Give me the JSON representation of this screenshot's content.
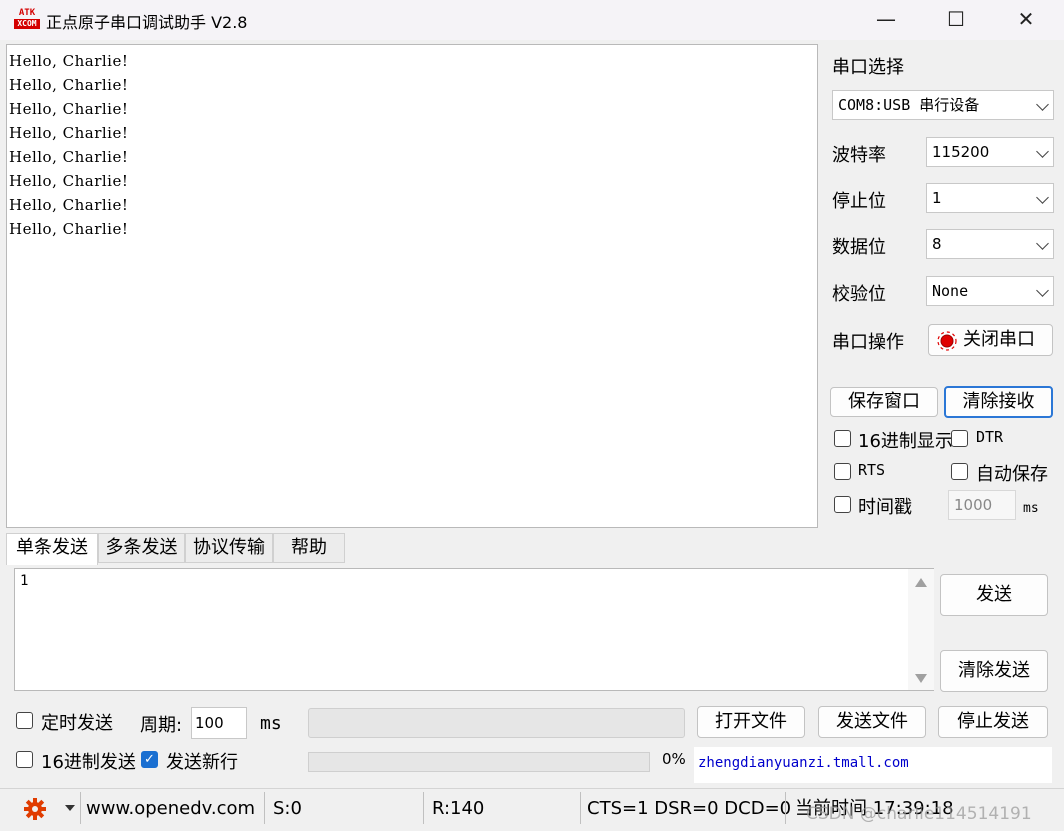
{
  "window": {
    "logo_top": "ATK",
    "logo_bottom": "XCOM",
    "title": "正点原子串口调试助手 V2.8",
    "minimize": "—",
    "maximize": "☐",
    "close": "✕"
  },
  "receive": {
    "lines": [
      "Hello, Charlie!",
      "Hello, Charlie!",
      "Hello, Charlie!",
      "Hello, Charlie!",
      "Hello, Charlie!",
      "Hello, Charlie!",
      "Hello, Charlie!",
      "Hello, Charlie!"
    ]
  },
  "serial": {
    "section_label": "串口选择",
    "port": "COM8:USB 串行设备",
    "baud_label": "波特率",
    "baud": "115200",
    "stopbits_label": "停止位",
    "stopbits": "1",
    "databits_label": "数据位",
    "databits": "8",
    "parity_label": "校验位",
    "parity": "None",
    "op_label": "串口操作",
    "op_button": "关闭串口",
    "save_window": "保存窗口",
    "clear_receive": "清除接收",
    "hex_display": "16进制显示",
    "dtr": "DTR",
    "rts": "RTS",
    "auto_save": "自动保存",
    "timestamp": "时间戳",
    "timestamp_value": "1000",
    "timestamp_unit": "ms",
    "status_color": "#e00000"
  },
  "tabs": [
    "单条发送",
    "多条发送",
    "协议传输",
    "帮助"
  ],
  "send": {
    "text": "1",
    "send_button": "发送",
    "clear_send": "清除发送",
    "timed_send": "定时发送",
    "period_label": "周期:",
    "period_value": "100",
    "period_unit": "ms",
    "open_file": "打开文件",
    "send_file": "发送文件",
    "stop_send": "停止发送",
    "hex_send": "16进制发送",
    "send_newline": "发送新行",
    "newline_checked": true,
    "progress": "0%",
    "url": "zhengdianyuanzi.tmall.com"
  },
  "statusbar": {
    "website": "www.openedv.com",
    "sent": "S:0",
    "received": "R:140",
    "signals": "CTS=1 DSR=0 DCD=0",
    "time": "当前时间 17:39:18",
    "watermark": "CSDN @charlie114514191"
  }
}
